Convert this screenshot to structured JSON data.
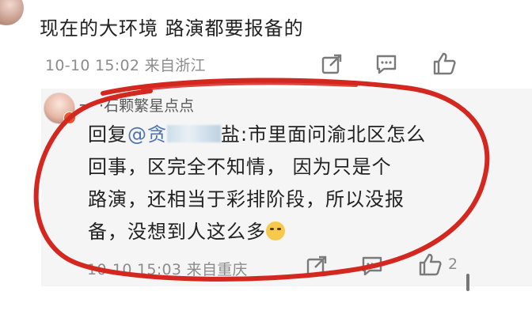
{
  "post": {
    "text": "现在的大环境 路演都要报备的",
    "meta": "10-10 15:02 来自浙江"
  },
  "reply": {
    "author": "一 ·石颗繁星点点",
    "line1_prefix": "回复",
    "mention": "@贪",
    "line1_suffix": "盐:市里面问渝北区怎么",
    "line2": "回事，区完全不知情， 因为只是个",
    "line3": "路演，还相当于彩排阶段，所以没报",
    "line4": "备，没想到人这么多",
    "meta": "10-10 15:03 来自重庆",
    "like_count": "2"
  },
  "colors": {
    "annotation": "#d4271f",
    "mention": "#4a74b0",
    "meta": "#8c8c8c"
  },
  "icons": [
    "share-icon",
    "comment-icon",
    "like-icon",
    "laughing-crying-emoji"
  ]
}
